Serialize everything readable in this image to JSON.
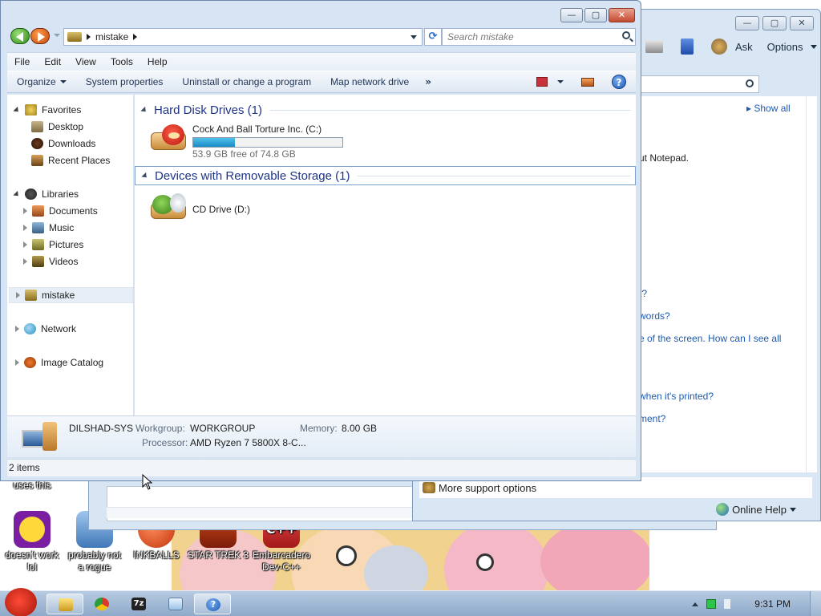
{
  "explorer": {
    "address_crumb": "mistake",
    "search_placeholder": "Search mistake",
    "menu": [
      "File",
      "Edit",
      "View",
      "Tools",
      "Help"
    ],
    "commands": {
      "organize": "Organize",
      "system_properties": "System properties",
      "uninstall": "Uninstall or change a program",
      "map_drive": "Map network drive",
      "more": "»"
    },
    "nav": {
      "favorites": "Favorites",
      "desktop": "Desktop",
      "downloads": "Downloads",
      "recent_places": "Recent Places",
      "libraries": "Libraries",
      "documents": "Documents",
      "music": "Music",
      "pictures": "Pictures",
      "videos": "Videos",
      "computer": "mistake",
      "network": "Network",
      "image_catalog": "Image Catalog"
    },
    "groups": {
      "hdd_header": "Hard Disk Drives (1)",
      "removable_header": "Devices with Removable Storage (1)"
    },
    "drives": {
      "c_name": "Cock And Ball Torture Inc. (C:)",
      "c_free": "53.9 GB free of 74.8 GB",
      "c_used_fraction": 0.279,
      "d_name": "CD Drive (D:)"
    },
    "details": {
      "computer_name": "DILSHAD-SYS",
      "workgroup_label": "Workgroup:",
      "workgroup_value": "WORKGROUP",
      "memory_label": "Memory:",
      "memory_value": "8.00 GB",
      "processor_label": "Processor:",
      "processor_value": "AMD Ryzen 7 5800X 8-C..."
    },
    "status": "2 items"
  },
  "help_window": {
    "ask": "Ask",
    "options": "Options",
    "show_all": "Show all",
    "lines": [
      "ut Notepad.",
      "t?",
      "words?",
      "e of the screen. How can I see all",
      "when it's printed?",
      "ment?"
    ],
    "more_support": "More support options",
    "online_help": "Online Help"
  },
  "desktop": {
    "partial_label": "uses this",
    "icons": [
      {
        "label_1": "doesn't work",
        "label_2": "lol"
      },
      {
        "label_1": "probably not",
        "label_2": "a rogue"
      },
      {
        "label_1": "INKBALLS",
        "label_2": ""
      },
      {
        "label_1": "STAR TREK 3",
        "label_2": ""
      },
      {
        "label_1": "Embarcadero",
        "label_2": "Dev-C++"
      }
    ]
  },
  "taskbar": {
    "clock": "9:31 PM"
  }
}
